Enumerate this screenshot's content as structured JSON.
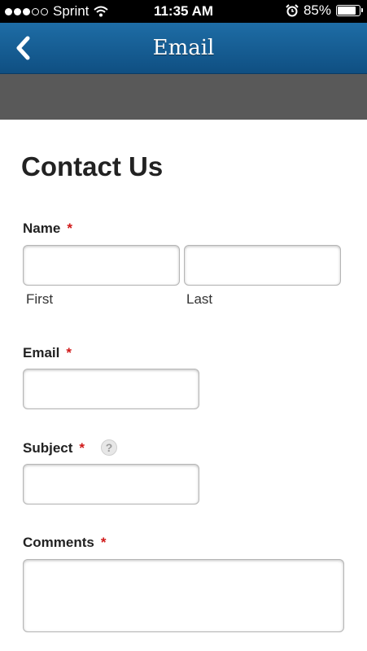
{
  "status_bar": {
    "carrier": "Sprint",
    "time": "11:35 AM",
    "battery_percent_text": "85%",
    "battery_level": 0.85,
    "signal_full": 3,
    "signal_total": 5
  },
  "nav": {
    "title": "Email",
    "back_icon": "chevron-left-icon"
  },
  "form": {
    "title": "Contact Us",
    "required_marker": "*",
    "name": {
      "label": "Name",
      "first_label": "First",
      "last_label": "Last",
      "first_value": "",
      "last_value": ""
    },
    "email": {
      "label": "Email",
      "value": ""
    },
    "subject": {
      "label": "Subject",
      "help_icon": "?",
      "value": ""
    },
    "comments": {
      "label": "Comments",
      "value": ""
    }
  },
  "colors": {
    "nav_bar": "#0f4f82",
    "gray_band": "#595959",
    "required": "#d01818"
  }
}
